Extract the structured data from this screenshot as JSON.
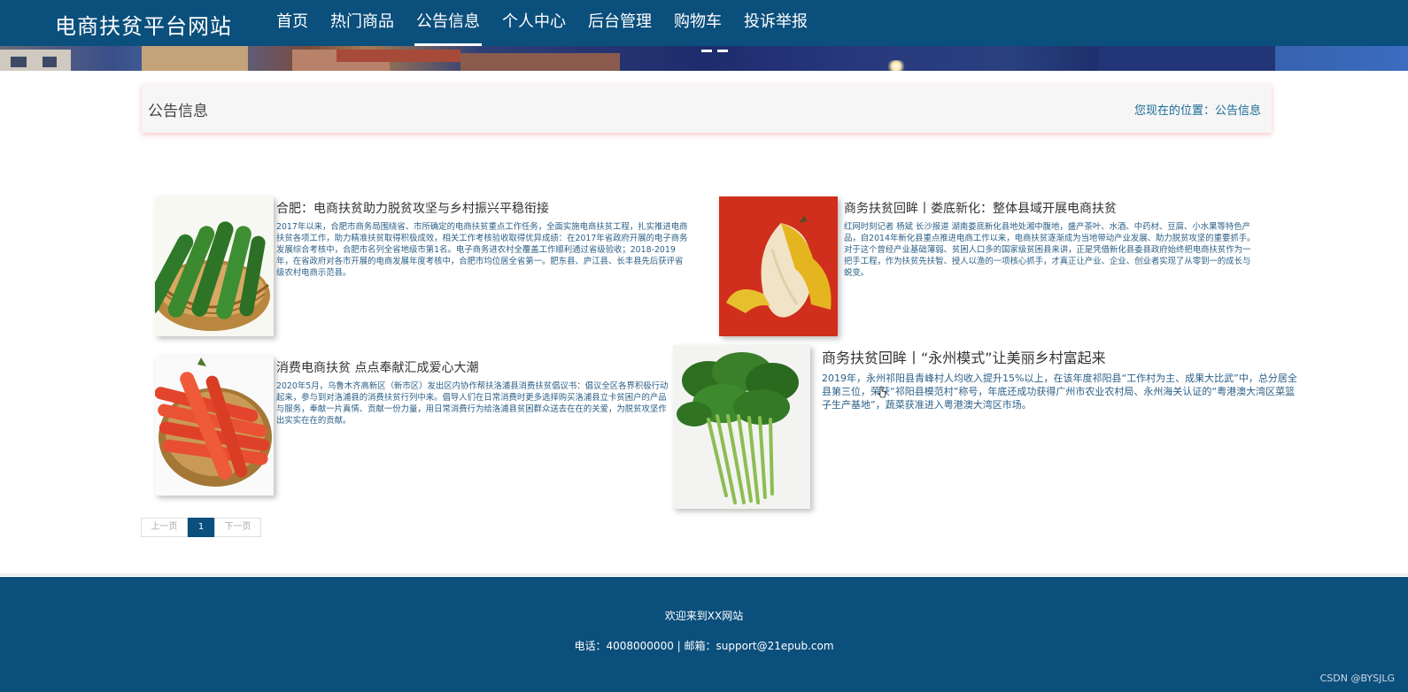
{
  "header": {
    "brand": "电商扶贫平台网站",
    "nav": [
      {
        "label": "首页"
      },
      {
        "label": "热门商品"
      },
      {
        "label": "公告信息",
        "active": true
      },
      {
        "label": "个人中心"
      },
      {
        "label": "后台管理"
      },
      {
        "label": "购物车"
      },
      {
        "label": "投诉举报"
      }
    ]
  },
  "breadcrumb": {
    "title": "公告信息",
    "location": "您现在的位置：公告信息"
  },
  "news": [
    {
      "title": "合肥：电商扶贫助力脱贫攻坚与乡村振兴平稳衔接",
      "summary": "2017年以来，合肥市商务局围绕省、市所确定的电商扶贫重点工作任务，全面实施电商扶贫工程，扎实推进电商扶贫各项工作，助力精准扶贫取得积极成效，相关工作考核验收取得优异成绩：在2017年省政府开展的电子商务发展综合考核中，合肥市名列全省地级市第1名。电子商务进农村全覆盖工作顺利通过省级验收；2018-2019年，在省政府对各市开展的电商发展年度考核中，合肥市均位居全省第一。肥东县、庐江县、长丰县先后获评省级农村电商示范县。",
      "image": "cucumber"
    },
    {
      "title": "商务扶贫回眸丨娄底新化：整体县域开展电商扶贫",
      "summary": "红网时刻记者 杨斌 长沙报道 湖南娄底新化县地处湘中腹地，盛产茶叶、水酒、中药材、豆腐、小水果等特色产品，自2014年新化县重点推进电商工作以来，电商扶贫逐渐成为当地带动产业发展、助力脱贫攻坚的重要抓手。对于这个曾经产业基础薄弱、贫困人口多的国家级贫困县来讲，正是凭借新化县委县政府始终把电商扶贫作为一把手工程，作为扶贫先扶智、授人以渔的一项核心抓手，才真正让产业、企业、创业者实现了从零到一的成长与蜕变。",
      "image": "banana"
    },
    {
      "title": "消费电商扶贫 点点奉献汇成爱心大潮",
      "summary": "2020年5月，乌鲁木齐高新区（新市区）发出区内协作帮扶洛浦县消费扶贫倡议书：倡议全区各界积极行动起来，参与到对洛浦县的消费扶贫行列中来。倡导人们在日常消费时更多选择购买洛浦县立卡贫困户的产品与服务，奉献一片真情、贡献一份力量，用日常消费行为给洛浦县贫困群众送去在在的关爱，为脱贫攻坚作出实实在在的贡献。",
      "image": "carrot"
    },
    {
      "title": "商务扶贫回眸丨“永州模式”让美丽乡村富起来",
      "summary": "2019年，永州祁阳县青峰村人均收入提升15%以上，在该年度祁阳县“工作村为主、成果大比武”中，总分居全县第三位，荣获“祁阳县模范村”称号，年底还成功获得广州市农业农村局、永州海关认证的“粤港澳大湾区菜篮子生产基地”，蔬菜获准进入粤港澳大湾区市场。",
      "image": "greens"
    }
  ],
  "pagination": {
    "prev": "上一页",
    "current": "1",
    "next": "下一页"
  },
  "footer": {
    "welcome": "欢迎来到XX网站",
    "contact": "电话：4008000000 | 邮箱：support@21epub.com",
    "credit": "CSDN @BYSJLG"
  }
}
